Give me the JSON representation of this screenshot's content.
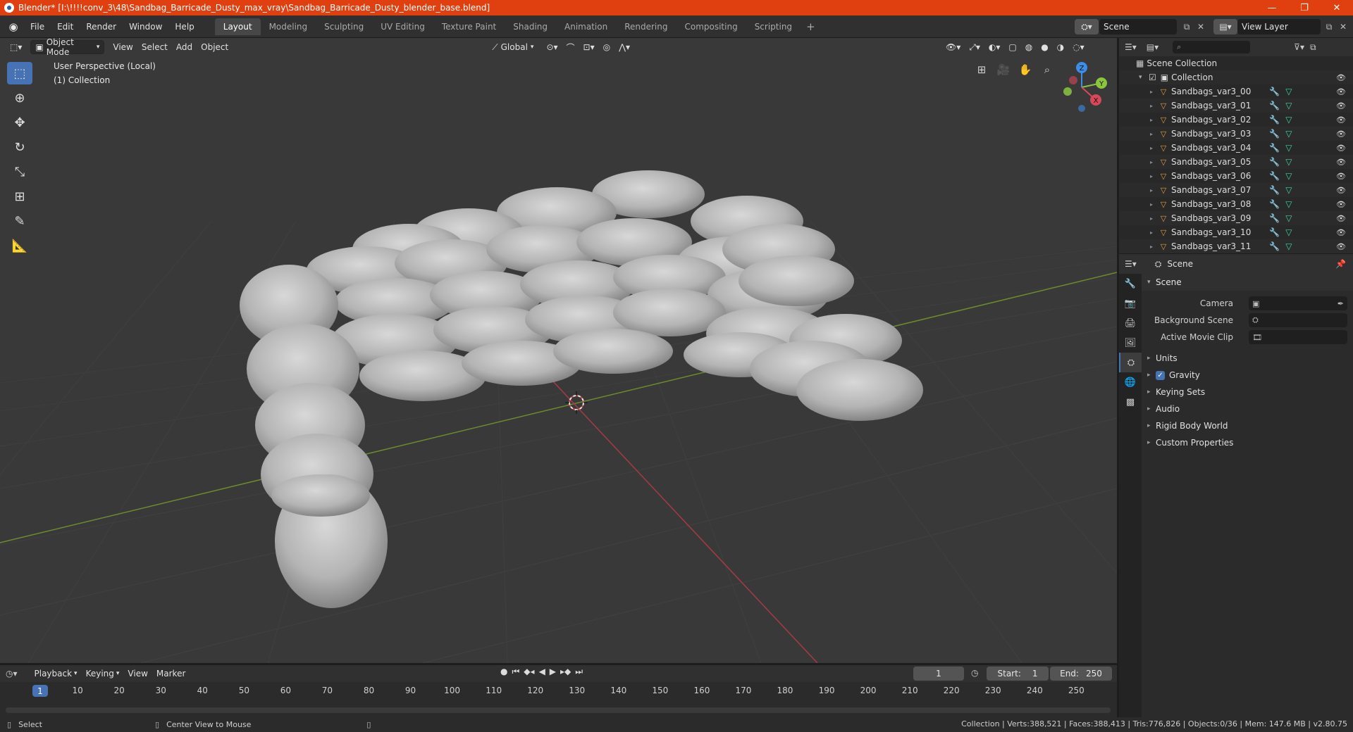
{
  "window": {
    "title": "Blender* [I:\\!!!!conv_3\\48\\Sandbag_Barricade_Dusty_max_vray\\Sandbag_Barricade_Dusty_blender_base.blend]",
    "minimize": "—",
    "restore": "❐",
    "close": "✕"
  },
  "menu": [
    "File",
    "Edit",
    "Render",
    "Window",
    "Help"
  ],
  "workspaces": [
    "Layout",
    "Modeling",
    "Sculpting",
    "UV Editing",
    "Texture Paint",
    "Shading",
    "Animation",
    "Rendering",
    "Compositing",
    "Scripting"
  ],
  "active_workspace": "Layout",
  "scene_selector": {
    "value": "Scene"
  },
  "view_layer_selector": {
    "value": "View Layer"
  },
  "viewport": {
    "mode": "Object Mode",
    "menus": [
      "View",
      "Select",
      "Add",
      "Object"
    ],
    "transform_orientation": "Global",
    "info_line1": "User Perspective (Local)",
    "info_line2": "(1) Collection",
    "axis_labels": {
      "x": "X",
      "y": "Y",
      "z": "Z"
    }
  },
  "outliner": {
    "search_placeholder": "",
    "scene_collection": "Scene Collection",
    "collection": "Collection",
    "objects": [
      "Sandbags_var3_00",
      "Sandbags_var3_01",
      "Sandbags_var3_02",
      "Sandbags_var3_03",
      "Sandbags_var3_04",
      "Sandbags_var3_05",
      "Sandbags_var3_06",
      "Sandbags_var3_07",
      "Sandbags_var3_08",
      "Sandbags_var3_09",
      "Sandbags_var3_10",
      "Sandbags_var3_11"
    ]
  },
  "properties": {
    "header": "Scene",
    "panel": "Scene",
    "camera_label": "Camera",
    "background_scene_label": "Background Scene",
    "active_movie_clip_label": "Active Movie Clip",
    "subpanels": [
      "Units",
      "Gravity",
      "Keying Sets",
      "Audio",
      "Rigid Body World",
      "Custom Properties"
    ],
    "gravity_checked": true
  },
  "timeline": {
    "menus": [
      "Playback",
      "Keying",
      "View",
      "Marker"
    ],
    "current_frame": "1",
    "start_label": "Start:",
    "start_value": "1",
    "end_label": "End:",
    "end_value": "250",
    "ruler_marker": "1",
    "ruler": [
      "10",
      "20",
      "30",
      "40",
      "50",
      "60",
      "70",
      "80",
      "90",
      "100",
      "110",
      "120",
      "130",
      "140",
      "150",
      "160",
      "170",
      "180",
      "190",
      "200",
      "210",
      "220",
      "230",
      "240",
      "250"
    ]
  },
  "statusbar": {
    "left_action": "Select",
    "mid_action": "Center View to Mouse",
    "stats": "Collection | Verts:388,521 | Faces:388,413 | Tris:776,826 | Objects:0/36 | Mem: 147.6 MB | v2.80.75"
  },
  "colors": {
    "titlebar": "#e0400f",
    "accent": "#4772b3",
    "viewport_bg": "#3a3a3a",
    "x_axis": "#d6485a",
    "y_axis": "#8ac53e",
    "z_axis": "#3c8ee6"
  }
}
